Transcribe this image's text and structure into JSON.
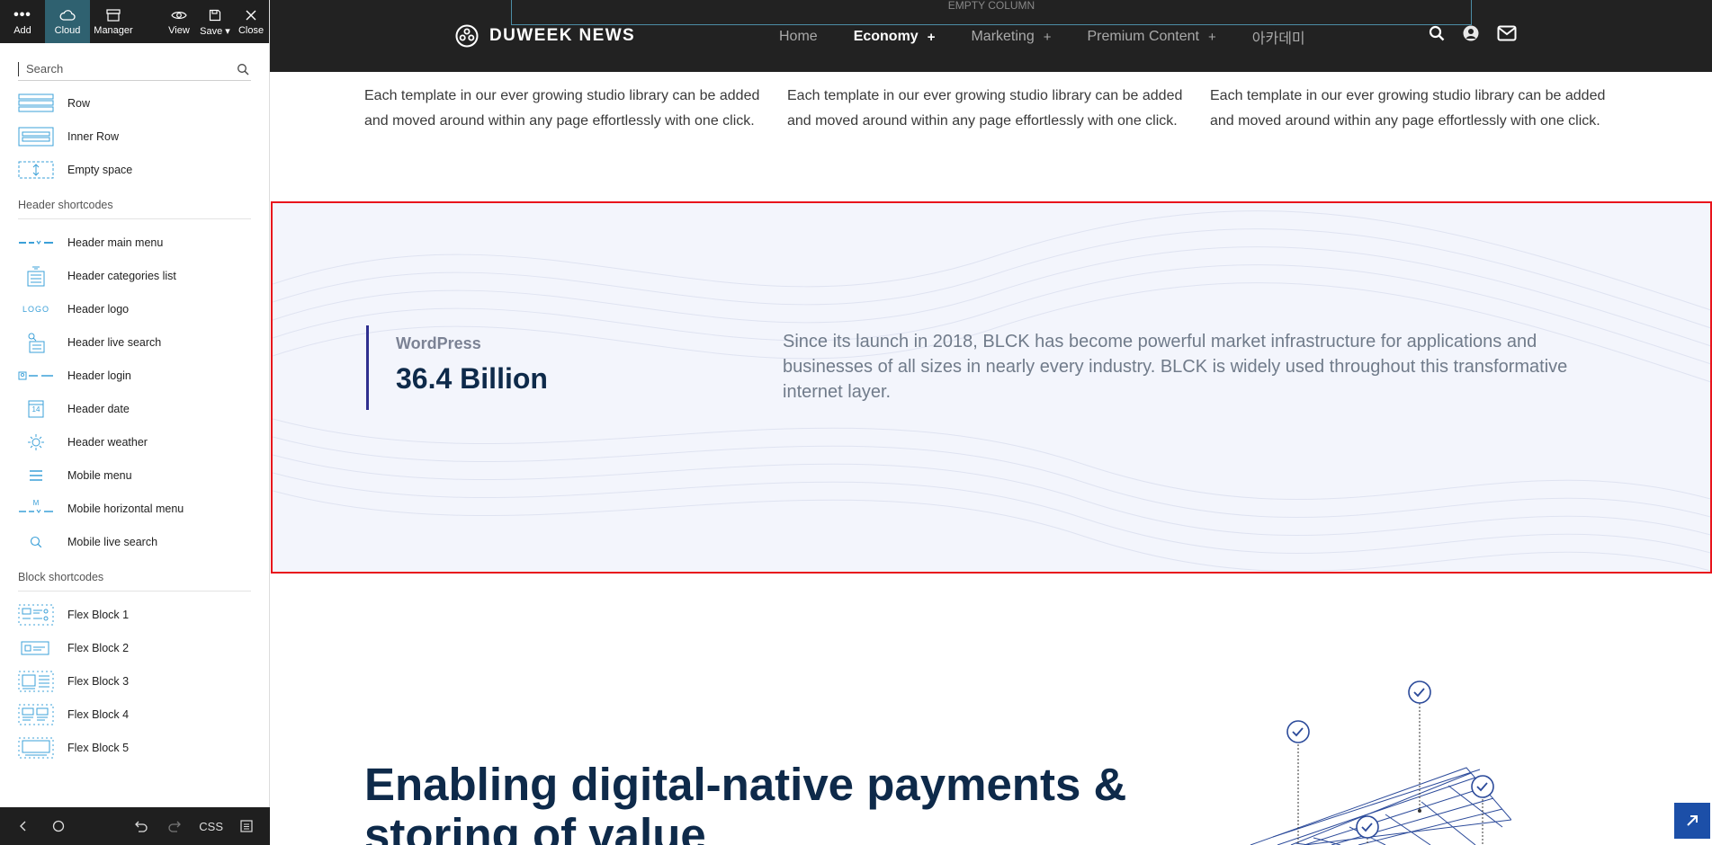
{
  "toolbar": {
    "add": "Add",
    "cloud": "Cloud",
    "manager": "Manager",
    "view": "View",
    "save": "Save",
    "close": "Close"
  },
  "search": {
    "placeholder": "Search"
  },
  "elements": {
    "basic": [
      {
        "label": "Row",
        "icon": "row-icon"
      },
      {
        "label": "Inner Row",
        "icon": "inner-row-icon"
      },
      {
        "label": "Empty space",
        "icon": "empty-space-icon"
      }
    ],
    "header_section": "Header shortcodes",
    "header": [
      {
        "label": "Header main menu",
        "icon": "header-main-menu-icon"
      },
      {
        "label": "Header categories list",
        "icon": "header-categories-icon"
      },
      {
        "label": "Header logo",
        "icon": "header-logo-icon",
        "icon_text": "LOGO"
      },
      {
        "label": "Header live search",
        "icon": "header-live-search-icon"
      },
      {
        "label": "Header login",
        "icon": "header-login-icon"
      },
      {
        "label": "Header date",
        "icon": "header-date-icon",
        "icon_text": "14"
      },
      {
        "label": "Header weather",
        "icon": "header-weather-icon"
      },
      {
        "label": "Mobile menu",
        "icon": "mobile-menu-icon"
      },
      {
        "label": "Mobile horizontal menu",
        "icon": "mobile-horizontal-menu-icon",
        "icon_text": "M"
      },
      {
        "label": "Mobile live search",
        "icon": "mobile-live-search-icon"
      }
    ],
    "block_section": "Block shortcodes",
    "blocks": [
      {
        "label": "Flex Block 1",
        "icon": "flex-block-icon"
      },
      {
        "label": "Flex Block 2",
        "icon": "flex-block-icon"
      },
      {
        "label": "Flex Block 3",
        "icon": "flex-block-icon"
      },
      {
        "label": "Flex Block 4",
        "icon": "flex-block-icon"
      },
      {
        "label": "Flex Block 5",
        "icon": "flex-block-icon"
      }
    ]
  },
  "bottom_bar": {
    "css": "CSS"
  },
  "site": {
    "empty_column": "EMPTY COLUMN",
    "brand": "DUWEEK NEWS",
    "nav": [
      {
        "label": "Home",
        "plus": ""
      },
      {
        "label": "Economy",
        "plus": "+"
      },
      {
        "label": "Marketing",
        "plus": "+"
      },
      {
        "label": "Premium Content",
        "plus": "+"
      },
      {
        "label": "아카데미",
        "plus": ""
      }
    ],
    "columns": [
      "Each template in our ever growing studio library can be added and moved around within any page effortlessly with one click.",
      "Each template in our ever growing studio library can be added and moved around within any page effortlessly with one click.",
      "Each template in our ever growing studio library can be added and moved around within any page effortlessly with one click."
    ],
    "stat": {
      "label": "WordPress",
      "value": "36.4 Billion"
    },
    "band_text": "Since its launch in 2018, BLCK has become powerful market infrastructure for applications and businesses of all sizes in nearly every industry. BLCK is widely used throughout this transformative internet layer.",
    "headline": "Enabling digital-native payments & storing of value"
  },
  "colors": {
    "topbar": "#222222",
    "band_bg": "#f3f5fc",
    "selection": "#e8141c",
    "stat_border": "#2f2f8f",
    "navy": "#0e2a4a",
    "accent_blue": "#1c4fa8",
    "toolbar_active": "#2f6170"
  }
}
